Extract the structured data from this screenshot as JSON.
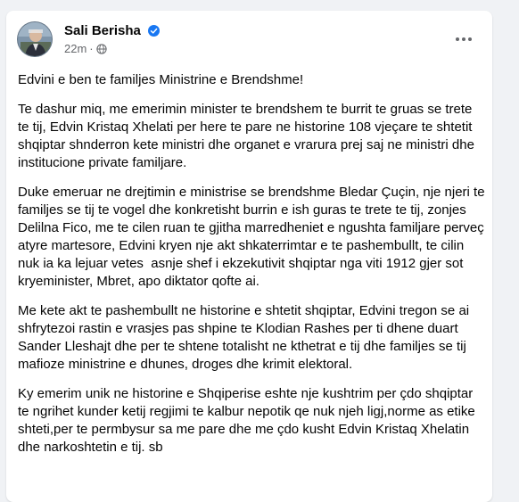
{
  "post": {
    "author": "Sali Berisha",
    "time": "22m",
    "paragraphs": [
      "Edvini e ben te familjes Ministrine e Brendshme!",
      "Te dashur miq, me emerimin minister te brendshem te burrit te gruas se trete te tij, Edvin Kristaq Xhelati per here te pare ne historine 108 vjeçare te shtetit shqiptar shnderron kete ministri dhe organet e vrarura prej saj ne ministri dhe institucione private familjare.",
      "Duke emeruar ne drejtimin e ministrise se brendshme Bledar Çuçin, nje njeri te familjes se tij te vogel dhe konkretisht burrin e ish guras te trete te tij, zonjes Delilna Fico, me te cilen ruan te gjitha marredheniet e ngushta familjare perveç atyre martesore, Edvini kryen nje akt shkaterrimtar e te pashembullt, te cilin nuk ia ka lejuar vetes  asnje shef i ekzekutivit shqiptar nga viti 1912 gjer sot kryeminister, Mbret, apo diktator qofte ai.",
      "Me kete akt te pashembullt ne historine e shtetit shqiptar, Edvini tregon se ai shfrytezoi rastin e vrasjes pas shpine te Klodian Rashes per ti dhene duart Sander Lleshajt dhe per te shtene totalisht ne kthetrat e tij dhe familjes se tij mafioze ministrine e dhunes, droges dhe krimit elektoral.",
      "Ky emerim unik ne historine e Shqiperise eshte nje kushtrim per çdo shqiptar te ngrihet kunder ketij regjimi te kalbur nepotik qe nuk njeh ligj,norme as etike shteti,per te permbysur sa me pare dhe me çdo kusht Edvin Kristaq Xhelatin dhe narkoshtetin e tij. sb"
    ]
  },
  "icons": {
    "verified": "verified-badge-icon",
    "audience": "globe-icon",
    "more": "more-options-icon"
  },
  "colors": {
    "verified": "#1877f2",
    "secondary_text": "#65676b",
    "primary_text": "#050505"
  }
}
